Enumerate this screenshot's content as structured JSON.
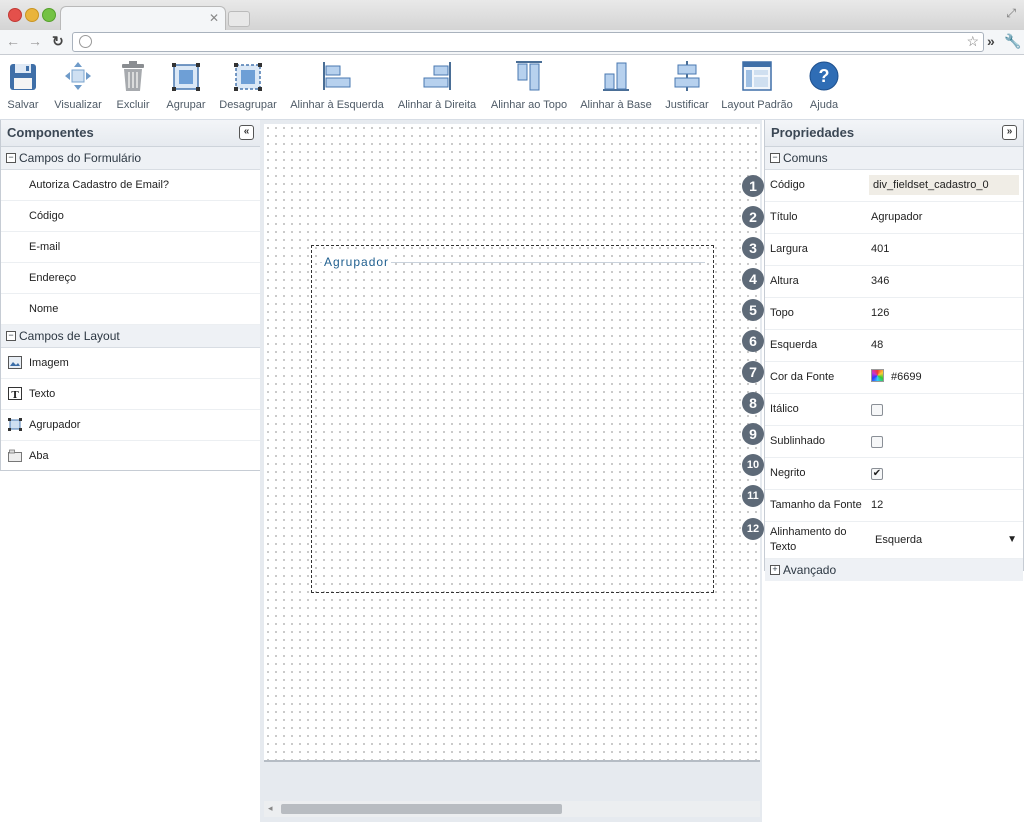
{
  "browser": {
    "controls": [
      "close",
      "minimize",
      "zoom"
    ],
    "icons": [
      "back-icon",
      "forward-icon",
      "reload-icon",
      "globe-icon",
      "star-icon",
      "extensions-icon",
      "wrench-icon"
    ]
  },
  "toolbar": {
    "items": [
      {
        "label": "Salvar",
        "icon": "save-icon"
      },
      {
        "label": "Visualizar",
        "icon": "preview-icon"
      },
      {
        "label": "Excluir",
        "icon": "trash-icon"
      },
      {
        "label": "Agrupar",
        "icon": "group-icon"
      },
      {
        "label": "Desagrupar",
        "icon": "ungroup-icon"
      },
      {
        "label": "Alinhar à Esquerda",
        "icon": "align-left-icon"
      },
      {
        "label": "Alinhar à Direita",
        "icon": "align-right-icon"
      },
      {
        "label": "Alinhar ao Topo",
        "icon": "align-top-icon"
      },
      {
        "label": "Alinhar à Base",
        "icon": "align-bottom-icon"
      },
      {
        "label": "Justificar",
        "icon": "justify-icon"
      },
      {
        "label": "Layout Padrão",
        "icon": "default-layout-icon"
      },
      {
        "label": "Ajuda",
        "icon": "help-icon"
      }
    ]
  },
  "components": {
    "title": "Componentes",
    "collapse_glyph": "«",
    "form_group": "Campos do Formulário",
    "form_items": [
      "Autoriza Cadastro de Email?",
      "Código",
      "E-mail",
      "Endereço",
      "Nome"
    ],
    "layout_group": "Campos de Layout",
    "layout_items": [
      {
        "label": "Imagem",
        "icon": "image-icon"
      },
      {
        "label": "Texto",
        "icon": "text-icon"
      },
      {
        "label": "Agrupador",
        "icon": "group-icon"
      },
      {
        "label": "Aba",
        "icon": "tab-icon"
      }
    ]
  },
  "canvas": {
    "fieldset_legend": "Agrupador",
    "scroll_left_glyph": "◂"
  },
  "properties": {
    "title": "Propriedades",
    "collapse_glyph": "»",
    "section_common": "Comuns",
    "section_advanced": "Avançado",
    "rows": {
      "codigo": {
        "num": "1",
        "label": "Código",
        "value": "div_fieldset_cadastro_0"
      },
      "titulo": {
        "num": "2",
        "label": "Título",
        "value": "Agrupador"
      },
      "largura": {
        "num": "3",
        "label": "Largura",
        "value": "401"
      },
      "altura": {
        "num": "4",
        "label": "Altura",
        "value": "346"
      },
      "topo": {
        "num": "5",
        "label": "Topo",
        "value": "126"
      },
      "esquerda": {
        "num": "6",
        "label": "Esquerda",
        "value": "48"
      },
      "cor": {
        "num": "7",
        "label": "Cor da Fonte",
        "value": "#6699"
      },
      "italico": {
        "num": "8",
        "label": "Itálico",
        "checked": false
      },
      "sublinhado": {
        "num": "9",
        "label": "Sublinhado",
        "checked": false
      },
      "negrito": {
        "num": "10",
        "label": "Negrito",
        "checked": true,
        "check_glyph": "✔"
      },
      "tamanho": {
        "num": "11",
        "label": "Tamanho da Fonte",
        "value": "12"
      },
      "alinhamento": {
        "num": "12",
        "label": "Alinhamento do Texto",
        "value": "Esquerda",
        "caret": "▼"
      }
    }
  },
  "colors": {
    "accent": "#1f5f8f",
    "badge": "#5e6a78"
  }
}
